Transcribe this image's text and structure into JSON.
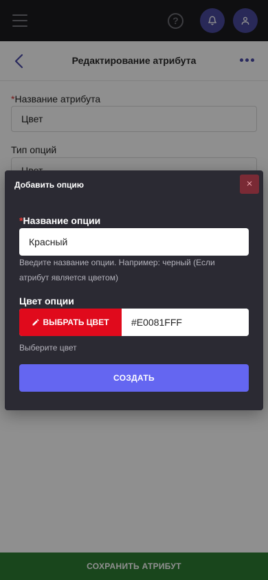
{
  "header": {
    "menu_icon": "hamburger-icon",
    "help_icon": "question-icon",
    "help_glyph": "?",
    "notification_icon": "bell-icon",
    "profile_icon": "user-icon"
  },
  "subheader": {
    "back_icon": "chevron-left-icon",
    "title": "Редактирование атрибута",
    "more_icon": "more-horizontal-icon"
  },
  "form": {
    "name_required": "*",
    "name_label": "Название атрибута",
    "name_value": "Цвет",
    "type_label": "Тип опций",
    "type_value": "Цвет"
  },
  "footer": {
    "save_label": "СОХРАНИТЬ АТРИБУТ"
  },
  "modal": {
    "title": "Добавить опцию",
    "close_glyph": "×",
    "option_name_required": "*",
    "option_name_label": "Название опции",
    "option_name_value": "Красный",
    "option_name_hint": "Введите название опции. Например: черный (Если атрибут является цветом)",
    "color_label": "Цвет опции",
    "pick_color_label": "ВЫБРАТЬ ЦВЕТ",
    "pick_color_icon": "pencil-icon",
    "color_value": "#E0081FFF",
    "color_hint": "Выберите цвет",
    "create_label": "СОЗДАТЬ"
  },
  "colors": {
    "selected_color": "#E0081F",
    "create_button": "#6466F1",
    "save_button": "#2E7D32"
  }
}
